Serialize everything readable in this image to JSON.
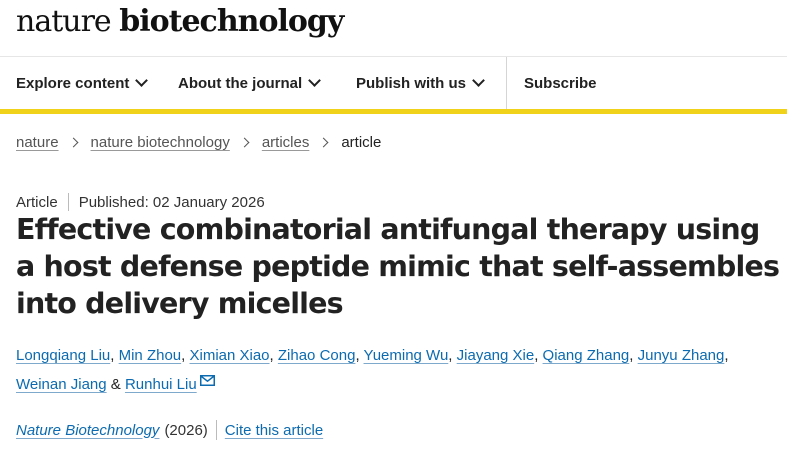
{
  "header": {
    "logo_light": "nature",
    "logo_bold": "biotechnology"
  },
  "nav": {
    "items": [
      {
        "label": "Explore content",
        "dropdown": true
      },
      {
        "label": "About the journal",
        "dropdown": true
      },
      {
        "label": "Publish with us",
        "dropdown": true
      },
      {
        "label": "Subscribe",
        "dropdown": false
      }
    ],
    "accent_color": "#f1d21a"
  },
  "breadcrumb": {
    "items": [
      "nature",
      "nature biotechnology",
      "articles"
    ],
    "current": "article"
  },
  "article": {
    "type": "Article",
    "published": "Published: 02 January 2026",
    "title": "Effective combinatorial antifungal therapy using a host defense peptide mimic that self-assembles into delivery micelles",
    "authors": [
      "Longqiang Liu",
      "Min Zhou",
      "Ximian Xiao",
      "Zihao Cong",
      "Yueming Wu",
      "Jiayang Xie",
      "Qiang Zhang",
      "Junyu Zhang",
      "Weinan Jiang",
      "Runhui Liu"
    ],
    "author_separator": ", ",
    "author_last_joiner": " & ",
    "corresponding_icon": "mail-icon",
    "journal": "Nature Biotechnology",
    "year": "(2026)",
    "cite_label": "Cite this article",
    "link_color": "#0c6bb0"
  }
}
